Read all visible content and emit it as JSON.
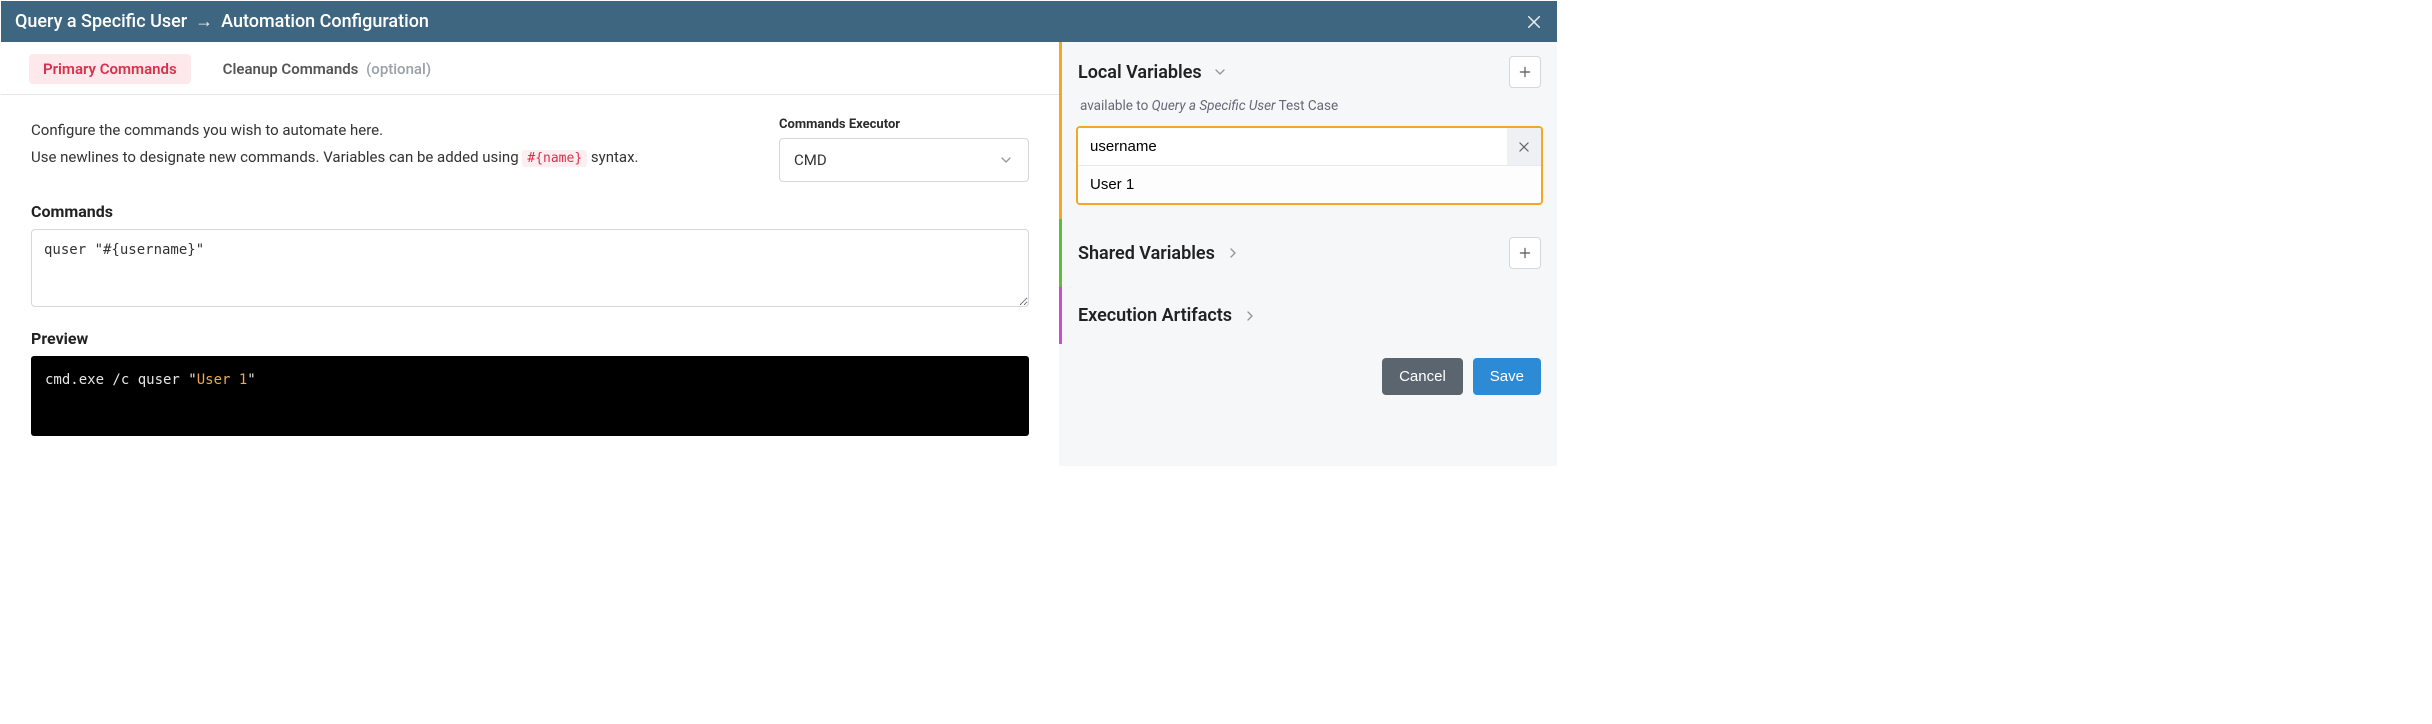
{
  "titlebar": {
    "breadcrumb_item": "Query a Specific User",
    "breadcrumb_arrow": "→",
    "breadcrumb_page": "Automation Configuration"
  },
  "tabs": {
    "primary": "Primary Commands",
    "cleanup": "Cleanup Commands",
    "cleanup_hint": "(optional)"
  },
  "intro": {
    "line1": "Configure the commands you wish to automate here.",
    "line2a": "Use newlines to designate new commands. Variables can be added using ",
    "token": "#{name}",
    "line2b": " syntax."
  },
  "executor": {
    "label": "Commands Executor",
    "value": "CMD"
  },
  "commands": {
    "label": "Commands",
    "value": "quser \"#{username}\""
  },
  "preview": {
    "label": "Preview",
    "prefix": "cmd.exe /c quser \"",
    "highlight": "User 1",
    "suffix": "\""
  },
  "right": {
    "local": {
      "title": "Local Variables",
      "subtitle_prefix": "available to ",
      "subtitle_italic": "Query a Specific User",
      "subtitle_suffix": " Test Case",
      "var_name": "username",
      "var_value": "User 1"
    },
    "shared": {
      "title": "Shared Variables"
    },
    "artifacts": {
      "title": "Execution Artifacts"
    }
  },
  "actions": {
    "cancel": "Cancel",
    "save": "Save"
  }
}
